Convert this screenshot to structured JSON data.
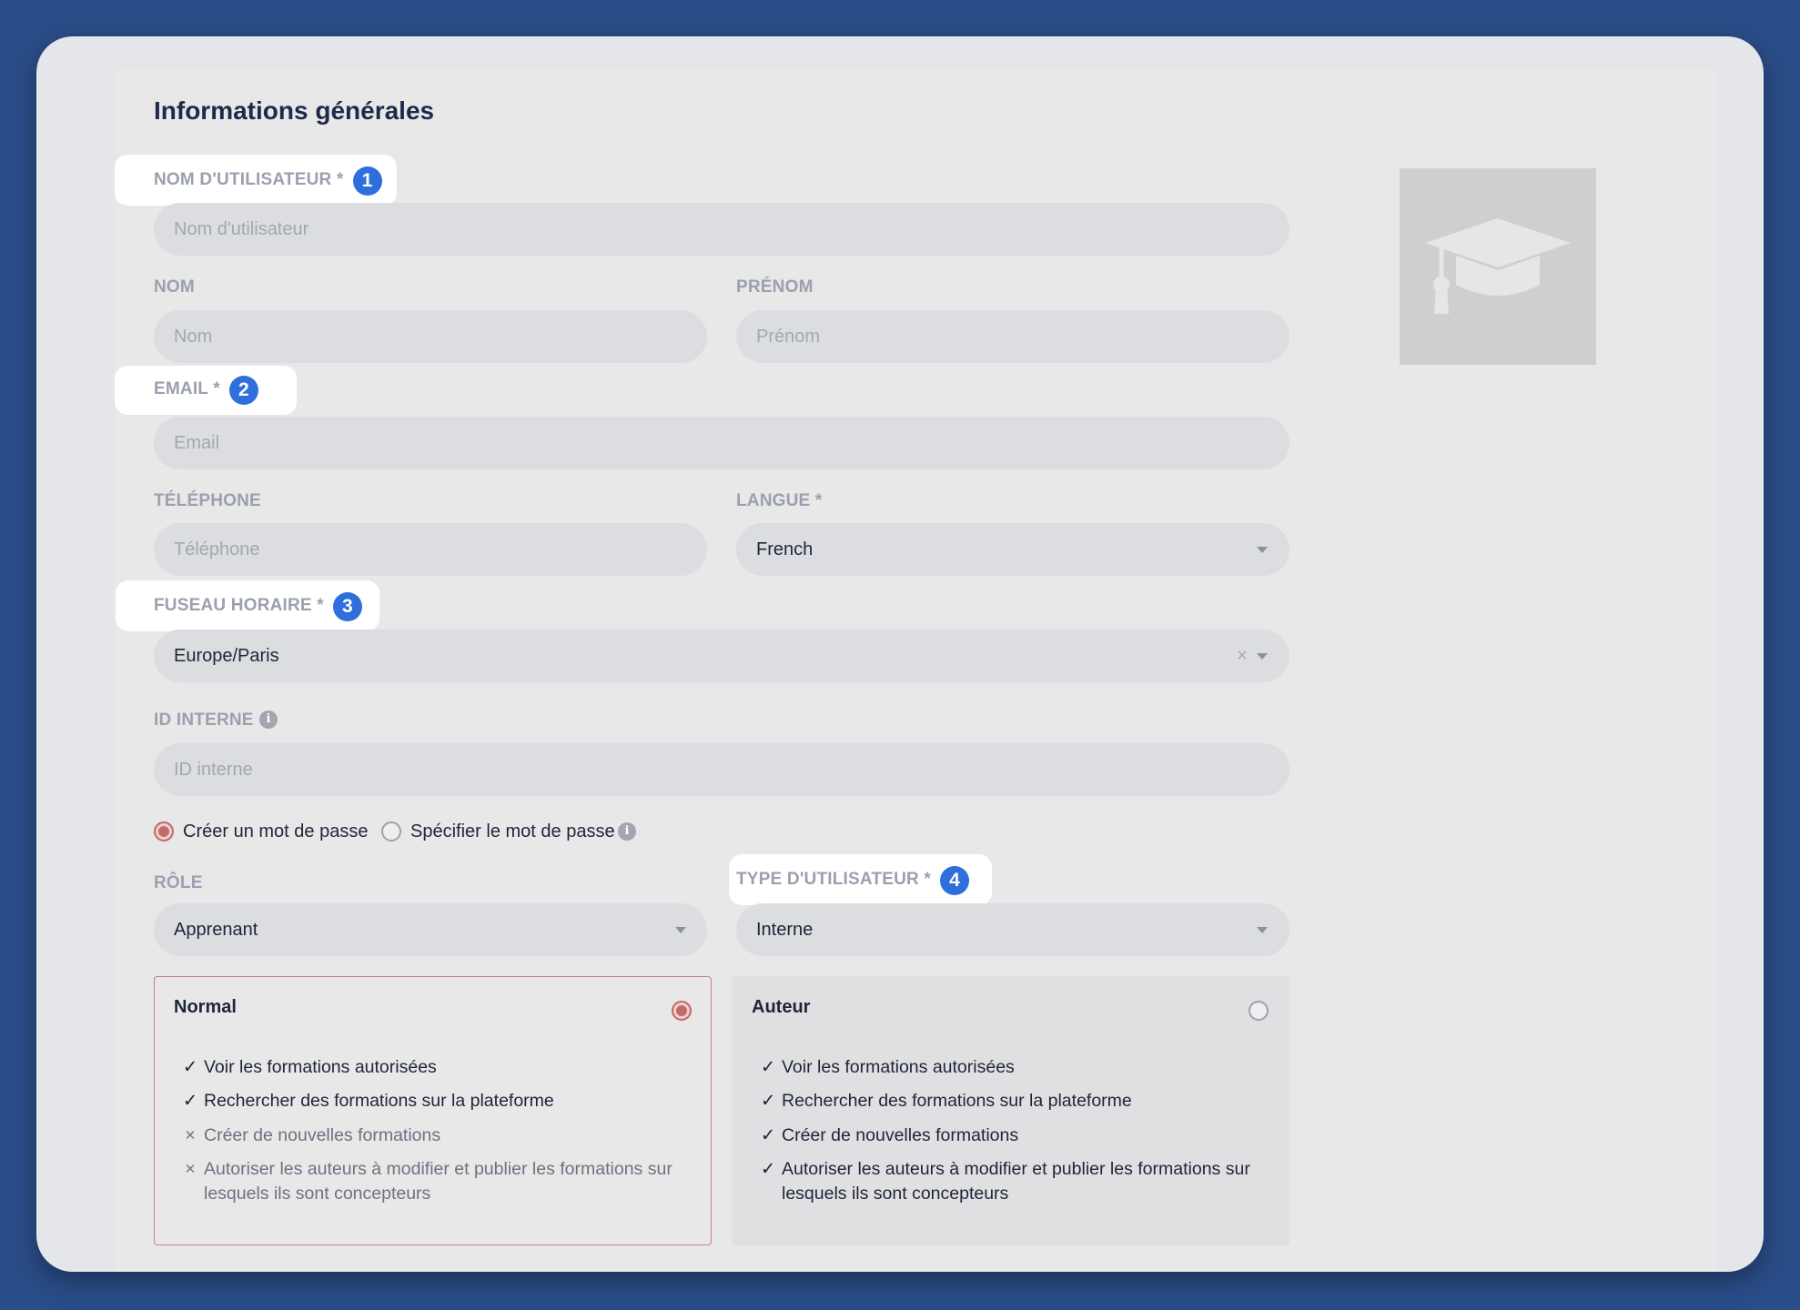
{
  "section_title": "Informations générales",
  "username": {
    "label": "NOM D'UTILISATEUR *",
    "badge": "1",
    "placeholder": "Nom d'utilisateur"
  },
  "last_name": {
    "label": "NOM",
    "placeholder": "Nom"
  },
  "first_name": {
    "label": "PRÉNOM",
    "placeholder": "Prénom"
  },
  "email": {
    "label": "EMAIL *",
    "badge": "2",
    "placeholder": "Email"
  },
  "phone": {
    "label": "TÉLÉPHONE",
    "placeholder": "Téléphone"
  },
  "language": {
    "label": "LANGUE *",
    "value": "French"
  },
  "timezone": {
    "label": "FUSEAU HORAIRE *",
    "badge": "3",
    "value": "Europe/Paris",
    "clear": "×"
  },
  "internal_id": {
    "label": "ID INTERNE",
    "placeholder": "ID interne",
    "info": "i"
  },
  "password": {
    "option_create": "Créer un mot de passe",
    "option_specify": "Spécifier le mot de passe",
    "selected": "create",
    "info": "i"
  },
  "role": {
    "label": "RÔLE",
    "value": "Apprenant"
  },
  "user_type": {
    "label": "TYPE D'UTILISATEUR *",
    "badge": "4",
    "value": "Interne"
  },
  "profiles": [
    {
      "name": "Normal",
      "selected": true,
      "features": [
        {
          "text": "Voir les formations autorisées",
          "allowed": true
        },
        {
          "text": "Rechercher des formations sur la plateforme",
          "allowed": true
        },
        {
          "text": "Créer de nouvelles formations",
          "allowed": false
        },
        {
          "text": "Autoriser les auteurs à modifier et publier les formations sur",
          "text2": "lesquels ils sont concepteurs",
          "allowed": false
        }
      ]
    },
    {
      "name": "Auteur",
      "selected": false,
      "features": [
        {
          "text": "Voir les formations autorisées",
          "allowed": true
        },
        {
          "text": "Rechercher des formations sur la plateforme",
          "allowed": true
        },
        {
          "text": "Créer de nouvelles formations",
          "allowed": true
        },
        {
          "text": "Autoriser les auteurs à modifier et publier les formations sur",
          "text2": "lesquels ils sont concepteurs",
          "allowed": true
        }
      ]
    }
  ],
  "marks": {
    "check": "✓",
    "cross": "×"
  },
  "colors": {
    "background": "#2a4d88",
    "badge": "#2f6fdc",
    "selected": "#c46a6a"
  },
  "icons": {
    "avatar": "graduation-cap-icon"
  }
}
